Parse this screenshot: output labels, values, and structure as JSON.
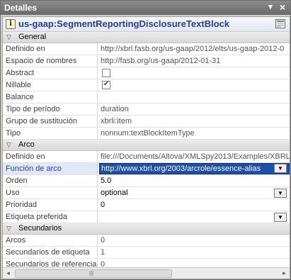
{
  "window": {
    "title": "Detalles",
    "pin_glyph": "▾",
    "close_glyph": "×"
  },
  "header": {
    "info_glyph": "i",
    "element_name": "us-gaap:SegmentReportingDisclosureTextBlock"
  },
  "sections": {
    "general": {
      "title": "General",
      "rows": [
        {
          "label": "Definido en",
          "value": "http://xbrl.fasb.org/us-gaap/2012/elts/us-gaap-2012-0"
        },
        {
          "label": "Espacio de nombres",
          "value": "http://fasb.org/us-gaap/2012-01-31"
        },
        {
          "label": "Abstract",
          "value": ""
        },
        {
          "label": "Nillable",
          "value": ""
        },
        {
          "label": "Balance",
          "value": ""
        },
        {
          "label": "Tipo de período",
          "value": "duration"
        },
        {
          "label": "Grupo de sustitución",
          "value": "xbrli:item"
        },
        {
          "label": "Tipo",
          "value": "nonnum:textBlockItemType"
        }
      ],
      "abstract_checked": false,
      "nillable_checked": true
    },
    "arco": {
      "title": "Arco",
      "rows": [
        {
          "label": "Definido en",
          "value": "file:///Documents/Altova/XMLSpy2013/Examples/XBRL"
        },
        {
          "label": "Función de arco",
          "value": "http://www.xbrl.org/2003/arcrole/essence-alias"
        },
        {
          "label": "Orden",
          "value": "5.0"
        },
        {
          "label": "Uso",
          "value": "optional"
        },
        {
          "label": "Prioridad",
          "value": "0"
        },
        {
          "label": "Etiqueta preferida",
          "value": ""
        }
      ]
    },
    "secundarios": {
      "title": "Secundarios",
      "rows": [
        {
          "label": "Arcos",
          "value": "0"
        },
        {
          "label": "Secundarios de etiqueta",
          "value": "1"
        },
        {
          "label": "Secundarios de referencia",
          "value": "0"
        }
      ]
    }
  },
  "scrollbar": {
    "left_arrow": "◂",
    "right_arrow": "▸",
    "grip": "|||"
  }
}
